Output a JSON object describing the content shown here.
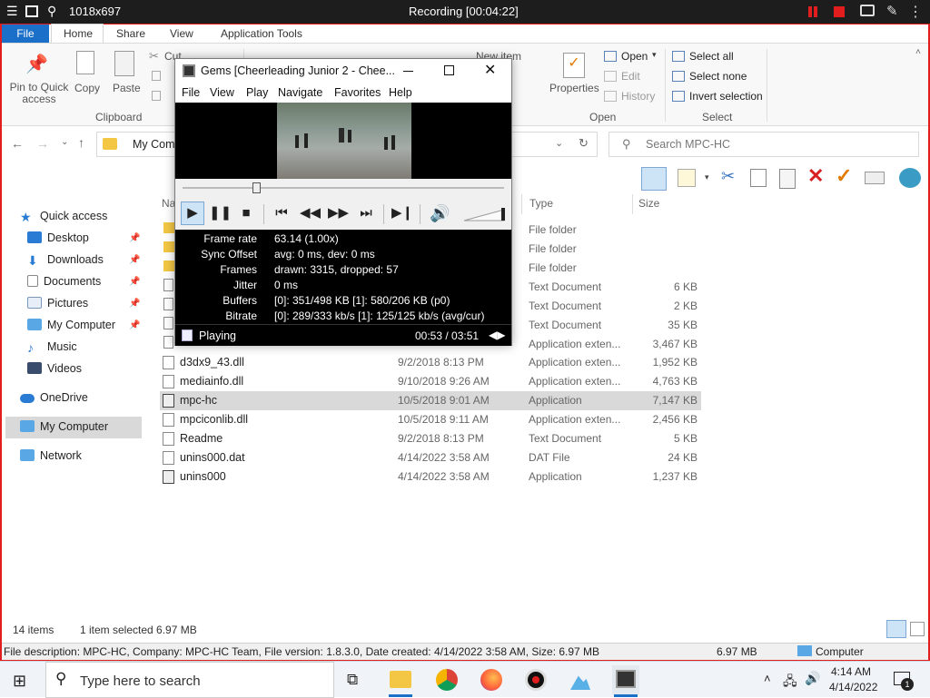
{
  "recorder": {
    "resolution": "1018x697",
    "status": "Recording [00:04:22]"
  },
  "ribbon": {
    "tabs": [
      "File",
      "Home",
      "Share",
      "View",
      "Application Tools"
    ],
    "clipboard": {
      "pin": "Pin to Quick access",
      "copy": "Copy",
      "paste": "Paste",
      "cut": "Cut",
      "group": "Clipboard"
    },
    "new_item": "New item",
    "open": {
      "properties": "Properties",
      "open": "Open",
      "edit": "Edit",
      "history": "History",
      "group": "Open"
    },
    "select": {
      "all": "Select all",
      "none": "Select none",
      "invert": "Invert selection",
      "group": "Select"
    }
  },
  "address": {
    "path": "My Com",
    "search_placeholder": "Search MPC-HC"
  },
  "nav": {
    "quick_access": "Quick access",
    "items": [
      "Desktop",
      "Downloads",
      "Documents",
      "Pictures",
      "My Computer",
      "Music",
      "Videos"
    ],
    "onedrive": "OneDrive",
    "my_computer": "My Computer",
    "network": "Network"
  },
  "columns": {
    "name": "Na",
    "type": "Type",
    "size": "Size"
  },
  "upper_rows": [
    {
      "type": "File folder",
      "size": ""
    },
    {
      "type": "File folder",
      "size": ""
    },
    {
      "type": "File folder",
      "size": ""
    },
    {
      "type": "Text Document",
      "size": "6 KB"
    },
    {
      "type": "Text Document",
      "size": "2 KB"
    },
    {
      "type": "Text Document",
      "size": "35 KB"
    },
    {
      "type": "Application exten...",
      "size": "3,467 KB"
    }
  ],
  "files": [
    {
      "name": "d3dx9_43.dll",
      "date": "9/2/2018 8:13 PM",
      "type": "Application exten...",
      "size": "1,952 KB"
    },
    {
      "name": "mediainfo.dll",
      "date": "9/10/2018 9:26 AM",
      "type": "Application exten...",
      "size": "4,763 KB"
    },
    {
      "name": "mpc-hc",
      "date": "10/5/2018 9:01 AM",
      "type": "Application",
      "size": "7,147 KB"
    },
    {
      "name": "mpciconlib.dll",
      "date": "10/5/2018 9:11 AM",
      "type": "Application exten...",
      "size": "2,456 KB"
    },
    {
      "name": "Readme",
      "date": "9/2/2018 8:13 PM",
      "type": "Text Document",
      "size": "5 KB"
    },
    {
      "name": "unins000.dat",
      "date": "4/14/2022 3:58 AM",
      "type": "DAT File",
      "size": "24 KB"
    },
    {
      "name": "unins000",
      "date": "4/14/2022 3:58 AM",
      "type": "Application",
      "size": "1,237 KB"
    }
  ],
  "mpc": {
    "title": "Gems  [Cheerleading Junior 2 - Chee...",
    "menu": [
      "File",
      "View",
      "Play",
      "Navigate",
      "Favorites",
      "Help"
    ],
    "stats": [
      {
        "label": "Frame rate",
        "value": "63.14 (1.00x)"
      },
      {
        "label": "Sync Offset",
        "value": "avg: 0 ms, dev: 0 ms"
      },
      {
        "label": "Frames",
        "value": "drawn: 3315, dropped: 57"
      },
      {
        "label": "Jitter",
        "value": "0 ms"
      },
      {
        "label": "Buffers",
        "value": "[0]: 351/498 KB [1]: 580/206 KB (p0)"
      },
      {
        "label": "Bitrate",
        "value": "[0]: 289/333 kb/s [1]: 125/125 kb/s (avg/cur)"
      }
    ],
    "status": "Playing",
    "time": "00:53 / 03:51",
    "seek_fraction": 0.23
  },
  "statusbar": {
    "items": "14 items",
    "selected": "1 item selected  6.97 MB"
  },
  "descbar": {
    "description": "File description: MPC-HC, Company: MPC-HC Team, File version: 1.8.3.0, Date created: 4/14/2022 3:58 AM, Size: 6.97 MB",
    "size": "6.97 MB",
    "location": "Computer"
  },
  "taskbar": {
    "search_placeholder": "Type here to search",
    "time": "4:14 AM",
    "date": "4/14/2022",
    "notifications": "1"
  },
  "colors": {
    "accent": "#1a6fc9",
    "record": "#e21d1d",
    "selection": "#d9d9d9"
  }
}
